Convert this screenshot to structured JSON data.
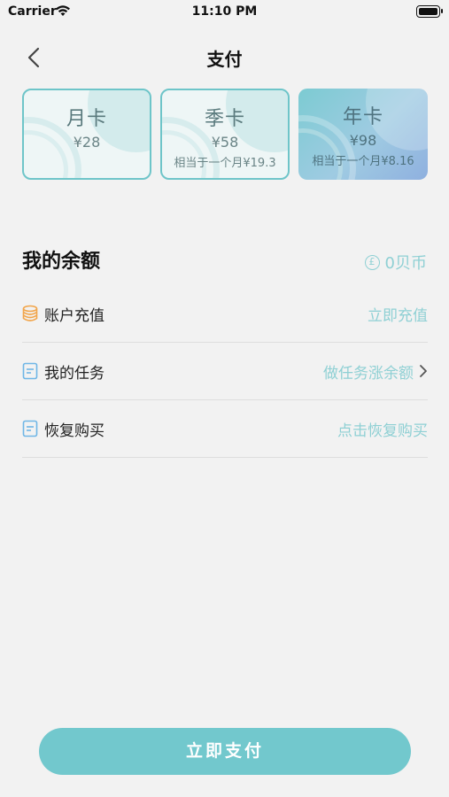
{
  "status_bar": {
    "carrier": "Carrier",
    "time": "11:10 PM"
  },
  "nav": {
    "title": "支付"
  },
  "plans": [
    {
      "name": "月卡",
      "price": "¥28",
      "note": ""
    },
    {
      "name": "季卡",
      "price": "¥58",
      "note": "相当于一个月¥19.3"
    },
    {
      "name": "年卡",
      "price": "¥98",
      "note": "相当于一个月¥8.16"
    }
  ],
  "balance": {
    "title": "我的余额",
    "value": "0贝币",
    "coin_symbol": "£"
  },
  "list": [
    {
      "label": "账户充值",
      "action": "立即充值",
      "icon": "coins-icon"
    },
    {
      "label": "我的任务",
      "action": "做任务涨余额",
      "icon": "document-icon"
    },
    {
      "label": "恢复购买",
      "action": "点击恢复购买",
      "icon": "document-icon"
    }
  ],
  "pay_button": {
    "label": "立即支付"
  },
  "colors": {
    "accent": "#72c8cd",
    "accent_text": "#8fd0d4",
    "coin_orange": "#f2a54a"
  }
}
